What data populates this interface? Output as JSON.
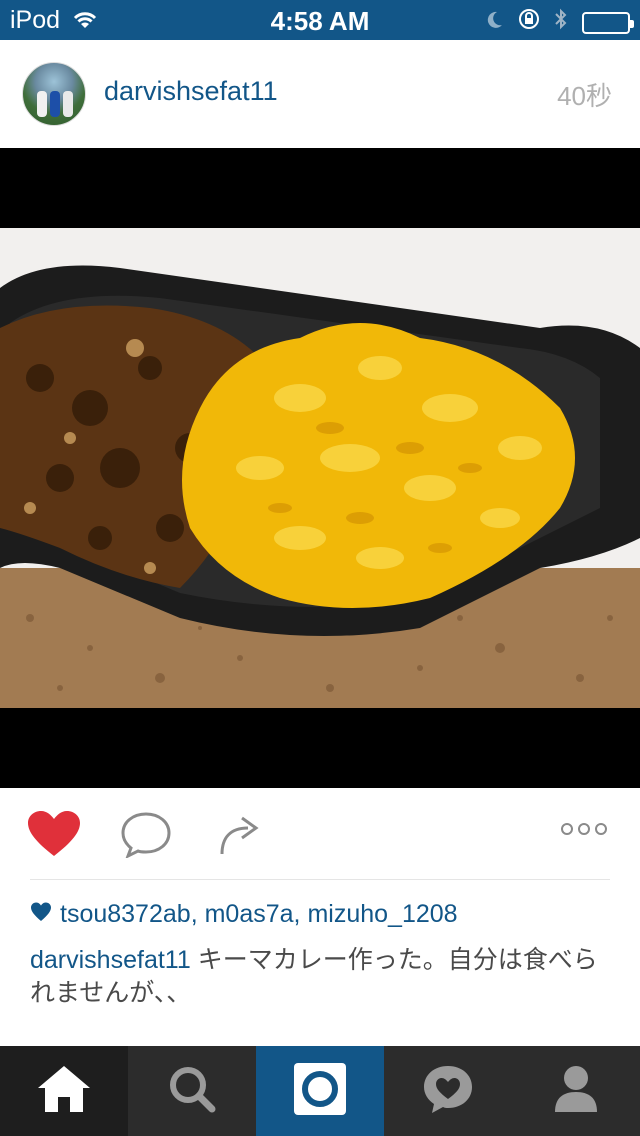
{
  "status_bar": {
    "carrier": "iPod",
    "time": "4:58 AM"
  },
  "post": {
    "username": "darvishsefat11",
    "timestamp": "40秒",
    "photo_icon": "food-photo-curry-and-saffron-rice"
  },
  "actions": {
    "icons": [
      "heart-icon",
      "comment-icon",
      "share-icon",
      "more-icon"
    ],
    "like_color": "#e0303a"
  },
  "likes": {
    "users": [
      "tsou8372ab",
      "m0as7a",
      "mizuho_1208"
    ],
    "separator": ", "
  },
  "caption": {
    "username": "darvishsefat11",
    "text": " キーマカレー作った。自分は食べられませんが、、"
  },
  "tabbar": {
    "tabs": [
      "home-icon",
      "search-icon",
      "camera-icon",
      "activity-icon",
      "profile-icon"
    ],
    "active_color": "#125688"
  },
  "colors": {
    "brand": "#125688",
    "tabbar_bg": "#2c2c2c"
  }
}
